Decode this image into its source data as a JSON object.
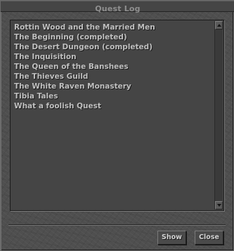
{
  "window": {
    "title": "Quest Log"
  },
  "quests": [
    {
      "label": "Rottin Wood and the Married Men"
    },
    {
      "label": "The Beginning (completed)"
    },
    {
      "label": "The Desert Dungeon (completed)"
    },
    {
      "label": "The Inquisition"
    },
    {
      "label": "The Queen of the Banshees"
    },
    {
      "label": "The Thieves Guild"
    },
    {
      "label": "The White Raven Monastery"
    },
    {
      "label": "Tibia Tales"
    },
    {
      "label": "What a foolish Quest"
    }
  ],
  "buttons": {
    "show_label": "Show",
    "close_label": "Close"
  },
  "colors": {
    "panel_background": "#4f4f4f",
    "list_background": "#454545",
    "text": "#c0c0c0",
    "title_text": "#8f8f8f"
  }
}
